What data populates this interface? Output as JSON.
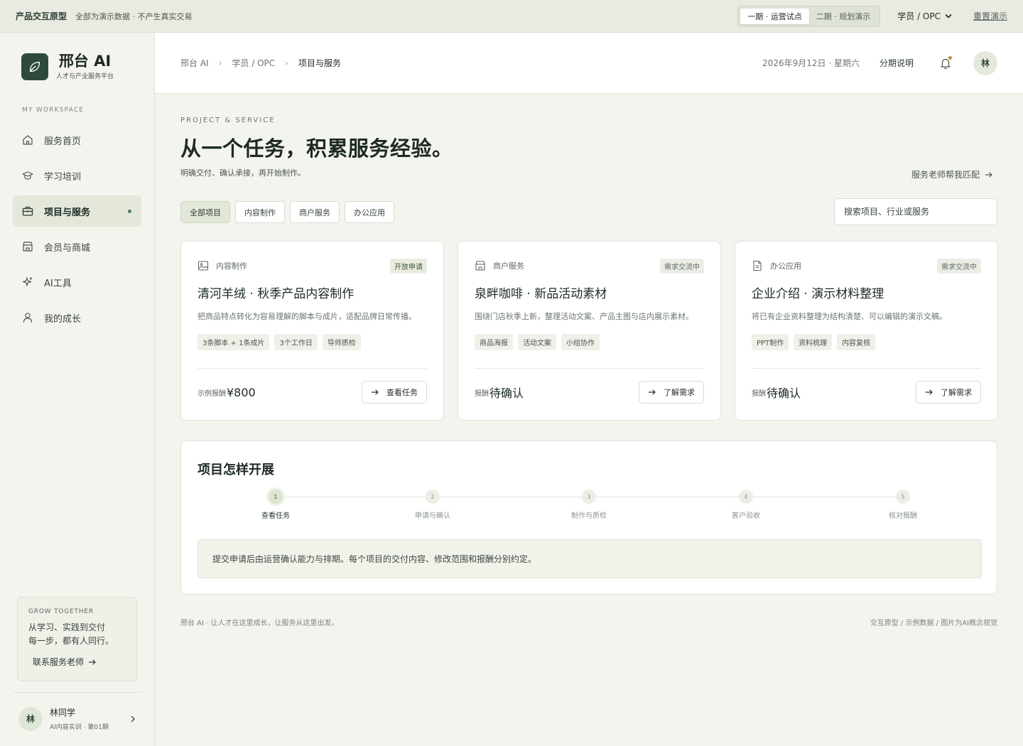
{
  "topbar": {
    "proto_label": "产品交互原型",
    "note": "全部为演示数据 · 不产生真实交易",
    "phases": [
      {
        "label": "一期 · 运营试点",
        "active": true
      },
      {
        "label": "二期 · 规划演示",
        "active": false
      }
    ],
    "role": "学员 / OPC",
    "reset": "重置演示"
  },
  "sidebar": {
    "brand_name": "邢台 AI",
    "brand_sub": "人才与产业服务平台",
    "workspace_label": "MY WORKSPACE",
    "items": [
      {
        "label": "服务首页",
        "icon": "home-icon",
        "active": false
      },
      {
        "label": "学习培训",
        "icon": "graduation-cap-icon",
        "active": false
      },
      {
        "label": "项目与服务",
        "icon": "briefcase-icon",
        "active": true
      },
      {
        "label": "会员与商城",
        "icon": "store-icon",
        "active": false
      },
      {
        "label": "AI工具",
        "icon": "sparkle-icon",
        "active": false
      },
      {
        "label": "我的成长",
        "icon": "user-icon",
        "active": false
      }
    ],
    "grow": {
      "title": "GROW TOGETHER",
      "text_line1": "从学习、实践到交付",
      "text_line2": "每一步，都有人同行。",
      "link": "联系服务老师"
    },
    "user": {
      "avatar": "林",
      "name": "林同学",
      "meta": "AI内容实训 · 第01期"
    }
  },
  "header": {
    "breadcrumbs": [
      "邢台 AI",
      "学员 / OPC",
      "项目与服务"
    ],
    "date": "2026年9月12日 · 星期六",
    "installment": "分期说明",
    "avatar": "林"
  },
  "main": {
    "eyebrow": "PROJECT & SERVICE",
    "title": "从一个任务，积累服务经验。",
    "lede": "明确交付、确认承接，再开始制作。",
    "match_link": "服务老师帮我匹配",
    "filters": [
      {
        "label": "全部项目",
        "active": true
      },
      {
        "label": "内容制作",
        "active": false
      },
      {
        "label": "商户服务",
        "active": false
      },
      {
        "label": "办公应用",
        "active": false
      }
    ],
    "search_placeholder": "搜索项目、行业或服务",
    "cards": [
      {
        "category": "内容制作",
        "icon": "image-icon",
        "badge": "开放申请",
        "title": "清河羊绒 · 秋季产品内容制作",
        "desc": "把商品特点转化为容易理解的脚本与成片，适配品牌日常传播。",
        "tags": [
          "3条脚本 + 1条成片",
          "3个工作日",
          "导师质检"
        ],
        "price_label": "示例报酬",
        "price": "¥800",
        "button": "查看任务"
      },
      {
        "category": "商户服务",
        "icon": "store-icon",
        "badge": "需求交流中",
        "title": "泉畔咖啡 · 新品活动素材",
        "desc": "围绕门店秋季上新，整理活动文案、产品主图与店内展示素材。",
        "tags": [
          "商品海报",
          "活动文案",
          "小组协作"
        ],
        "price_label": "报酬",
        "price": "待确认",
        "button": "了解需求"
      },
      {
        "category": "办公应用",
        "icon": "document-icon",
        "badge": "需求交流中",
        "title": "企业介绍 · 演示材料整理",
        "desc": "将已有企业资料整理为结构清楚、可以编辑的演示文稿。",
        "tags": [
          "PPT制作",
          "资料梳理",
          "内容复核"
        ],
        "price_label": "报酬",
        "price": "待确认",
        "button": "了解需求"
      }
    ],
    "howto": {
      "title": "项目怎样开展",
      "steps": [
        {
          "num": "1",
          "label": "查看任务",
          "active": true
        },
        {
          "num": "2",
          "label": "申请与确认",
          "active": false
        },
        {
          "num": "3",
          "label": "制作与质检",
          "active": false
        },
        {
          "num": "4",
          "label": "客户验收",
          "active": false
        },
        {
          "num": "5",
          "label": "核对报酬",
          "active": false
        }
      ],
      "info": "提交申请后由运营确认能力与排期。每个项目的交付内容、修改范围和报酬分别约定。"
    },
    "footer_left": "邢台 AI · 让人才在这里成长，让服务从这里出发。",
    "footer_right": "交互原型 / 示例数据 / 图片为AI概念视觉"
  }
}
